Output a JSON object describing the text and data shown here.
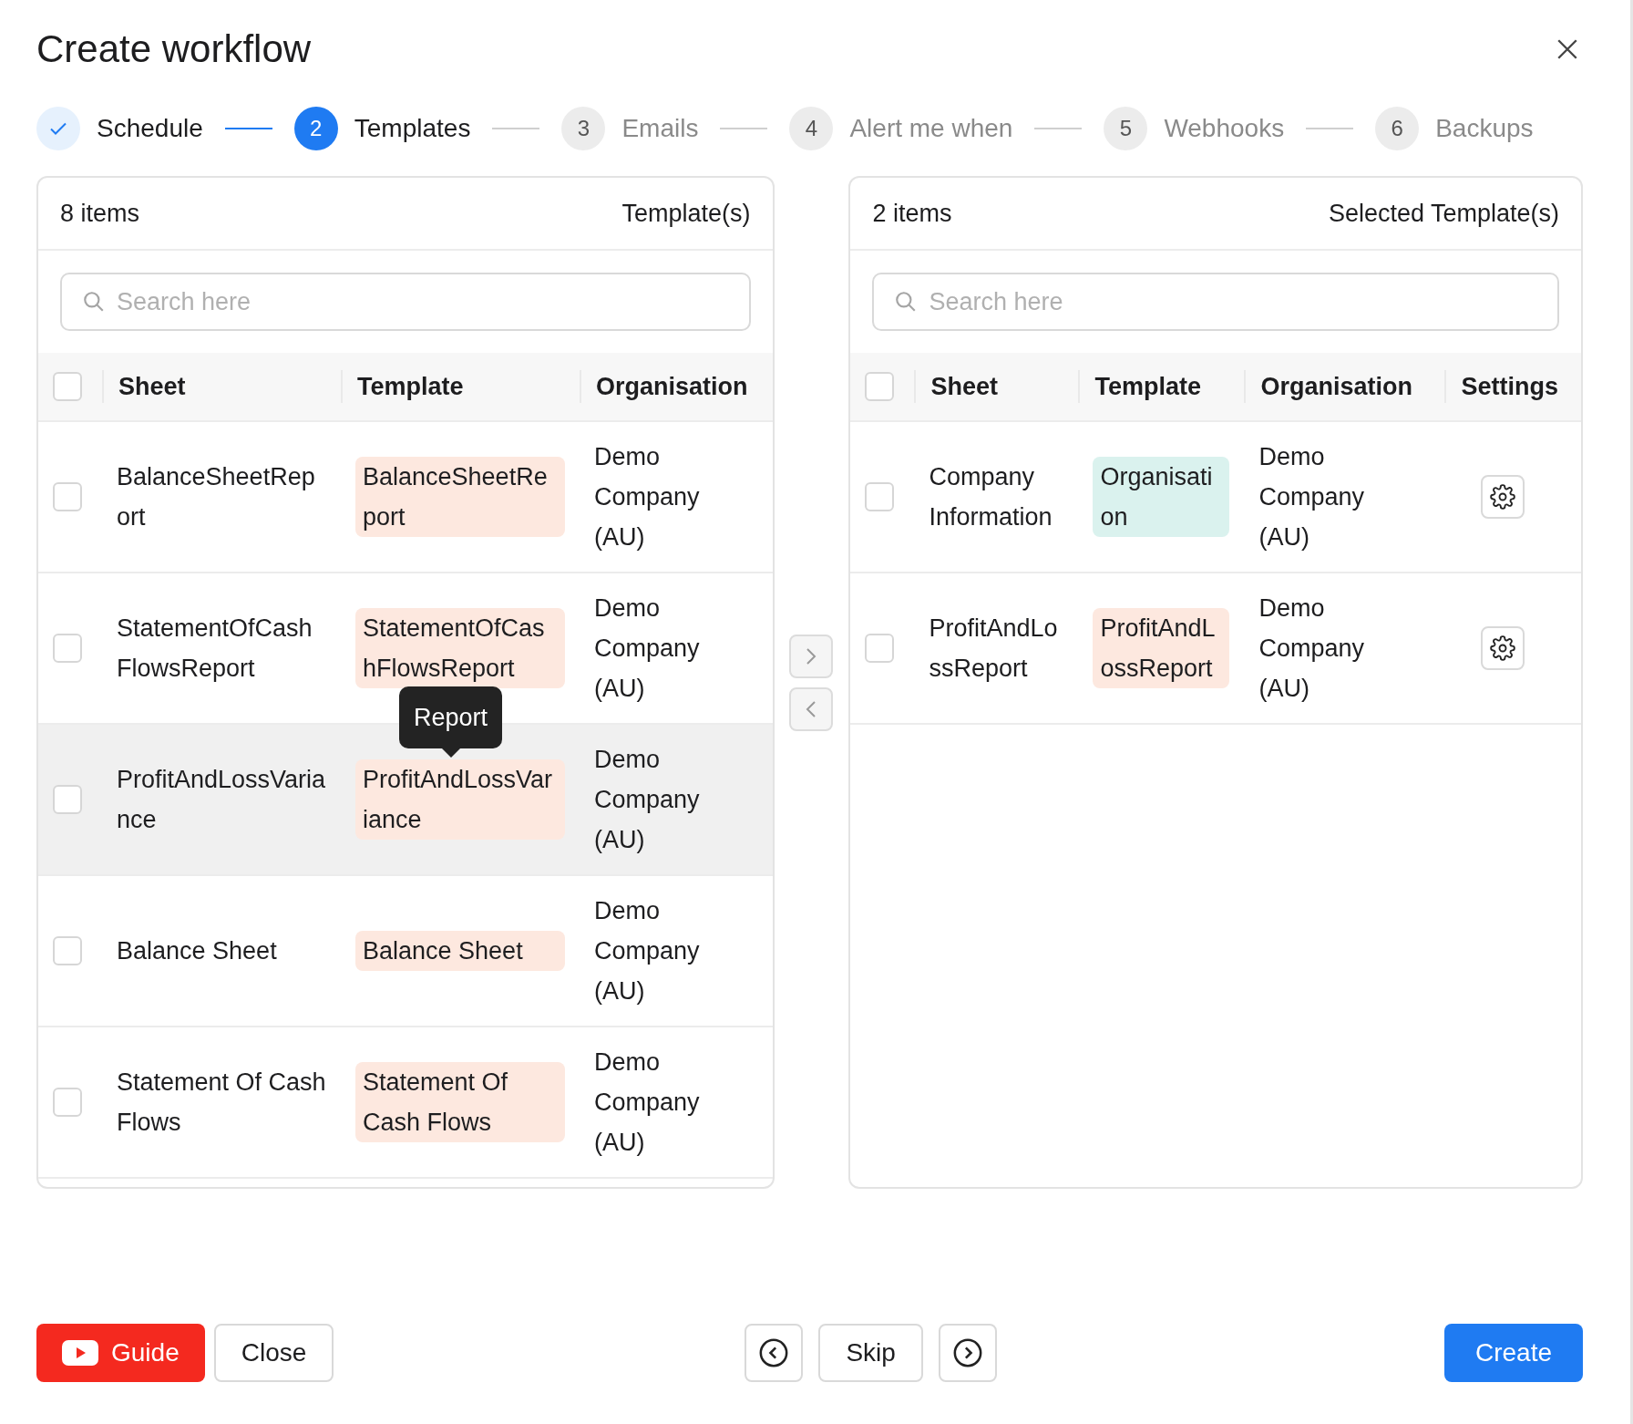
{
  "title": "Create workflow",
  "steps": [
    {
      "label": "Schedule",
      "done": true,
      "selected": false
    },
    {
      "number": "2",
      "label": "Templates",
      "done": false,
      "selected": true
    },
    {
      "number": "3",
      "label": "Emails",
      "done": false,
      "selected": false
    },
    {
      "number": "4",
      "label": "Alert me when",
      "done": false,
      "selected": false
    },
    {
      "number": "5",
      "label": "Webhooks",
      "done": false,
      "selected": false
    },
    {
      "number": "6",
      "label": "Backups",
      "done": false,
      "selected": false
    }
  ],
  "source": {
    "count": "8 items",
    "title": "Template(s)",
    "search": {
      "placeholder": "Search here"
    },
    "columns": [
      "Sheet",
      "Template",
      "Organisation"
    ],
    "all_checked": false,
    "rows": [
      {
        "checked": false,
        "hovered": false,
        "sheet": "BalanceSheetReport",
        "template": "BalanceSheetReport",
        "color": "#fde8df",
        "organisation": "Demo Company (AU)"
      },
      {
        "checked": false,
        "hovered": false,
        "sheet": "StatementOfCashFlowsReport",
        "template": "StatementOfCashFlowsReport",
        "color": "#fde8df",
        "organisation": "Demo Company (AU)"
      },
      {
        "checked": false,
        "hovered": true,
        "sheet": "ProfitAndLossVariance",
        "template": "ProfitAndLossVariance",
        "color": "#fde8df",
        "organisation": "Demo Company (AU)",
        "tooltip": "Report"
      },
      {
        "checked": false,
        "hovered": false,
        "sheet": "Balance Sheet",
        "template": "Balance Sheet",
        "color": "#fde8df",
        "organisation": "Demo Company (AU)"
      },
      {
        "checked": false,
        "hovered": false,
        "sheet": "Statement Of Cash Flows",
        "template": "Statement Of Cash Flows",
        "color": "#fde8df",
        "organisation": "Demo Company (AU)"
      }
    ]
  },
  "target": {
    "count": "2 items",
    "title": "Selected Template(s)",
    "search": {
      "placeholder": "Search here"
    },
    "columns": [
      "Sheet",
      "Template",
      "Organisation",
      "Settings"
    ],
    "all_checked": false,
    "rows": [
      {
        "checked": false,
        "sheet": "Company Information",
        "template": "Organisation",
        "color": "#daf2ee",
        "organisation": "Demo Company (AU)"
      },
      {
        "checked": false,
        "sheet": "ProfitAndLossReport",
        "template": "ProfitAndLossReport",
        "color": "#fde8df",
        "organisation": "Demo Company (AU)"
      }
    ]
  },
  "footer": {
    "guide": "Guide",
    "close": "Close",
    "skip": "Skip",
    "create": "Create"
  }
}
